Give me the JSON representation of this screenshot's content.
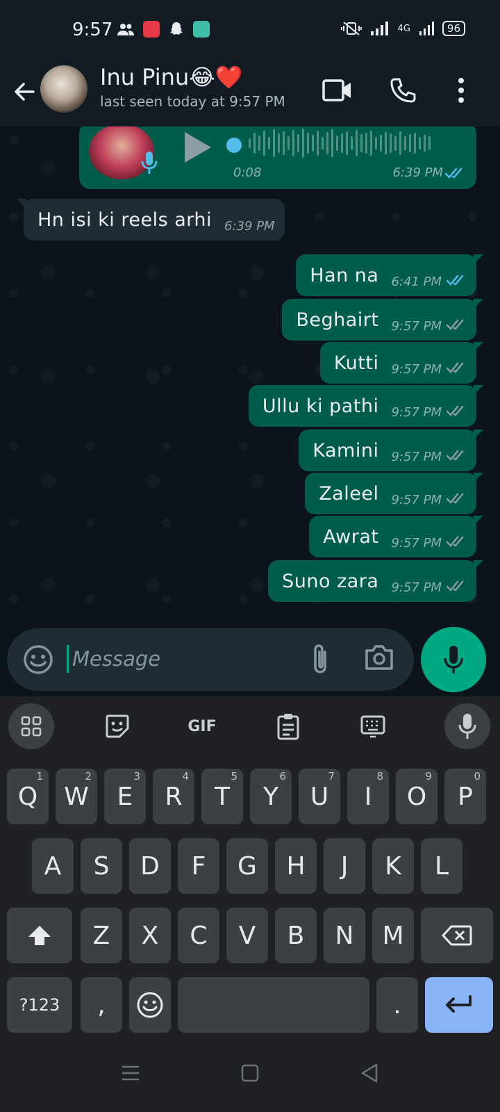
{
  "status_bar": {
    "time": "9:57",
    "network": "4G",
    "battery": "96"
  },
  "header": {
    "contact_name": "Inu Pinu😂❤️",
    "last_seen": "last seen today at 9:57 PM"
  },
  "voice_message": {
    "duration": "0:08",
    "time": "6:39 PM",
    "status": "read"
  },
  "messages": [
    {
      "direction": "incoming",
      "text": "Hn isi ki reels arhi",
      "time": "6:39 PM"
    },
    {
      "direction": "outgoing",
      "text": "Han na",
      "time": "6:41 PM",
      "status": "read"
    },
    {
      "direction": "outgoing",
      "text": "Beghairt",
      "time": "9:57 PM",
      "status": "delivered"
    },
    {
      "direction": "outgoing",
      "text": "Kutti",
      "time": "9:57 PM",
      "status": "delivered"
    },
    {
      "direction": "outgoing",
      "text": "Ullu ki pathi",
      "time": "9:57 PM",
      "status": "delivered"
    },
    {
      "direction": "outgoing",
      "text": "Kamini",
      "time": "9:57 PM",
      "status": "delivered"
    },
    {
      "direction": "outgoing",
      "text": "Zaleel",
      "time": "9:57 PM",
      "status": "delivered"
    },
    {
      "direction": "outgoing",
      "text": "Awrat",
      "time": "9:57 PM",
      "status": "delivered"
    },
    {
      "direction": "outgoing",
      "text": "Suno zara",
      "time": "9:57 PM",
      "status": "delivered"
    }
  ],
  "composer": {
    "placeholder": "Message",
    "value": ""
  },
  "keyboard": {
    "toolbar": {
      "gif_label": "GIF"
    },
    "row1": [
      {
        "key": "Q",
        "hint": "1"
      },
      {
        "key": "W",
        "hint": "2"
      },
      {
        "key": "E",
        "hint": "3"
      },
      {
        "key": "R",
        "hint": "4"
      },
      {
        "key": "T",
        "hint": "5"
      },
      {
        "key": "Y",
        "hint": "6"
      },
      {
        "key": "U",
        "hint": "7"
      },
      {
        "key": "I",
        "hint": "8"
      },
      {
        "key": "O",
        "hint": "9"
      },
      {
        "key": "P",
        "hint": "0"
      }
    ],
    "row2": [
      "A",
      "S",
      "D",
      "F",
      "G",
      "H",
      "J",
      "K",
      "L"
    ],
    "row3": [
      "Z",
      "X",
      "C",
      "V",
      "B",
      "N",
      "M"
    ],
    "symbols_label": "?123",
    "comma_label": ",",
    "period_label": "."
  },
  "colors": {
    "outgoing_bubble": "#005c4b",
    "incoming_bubble": "#202c33",
    "read_ticks": "#53bdeb",
    "accent": "#00a884"
  }
}
